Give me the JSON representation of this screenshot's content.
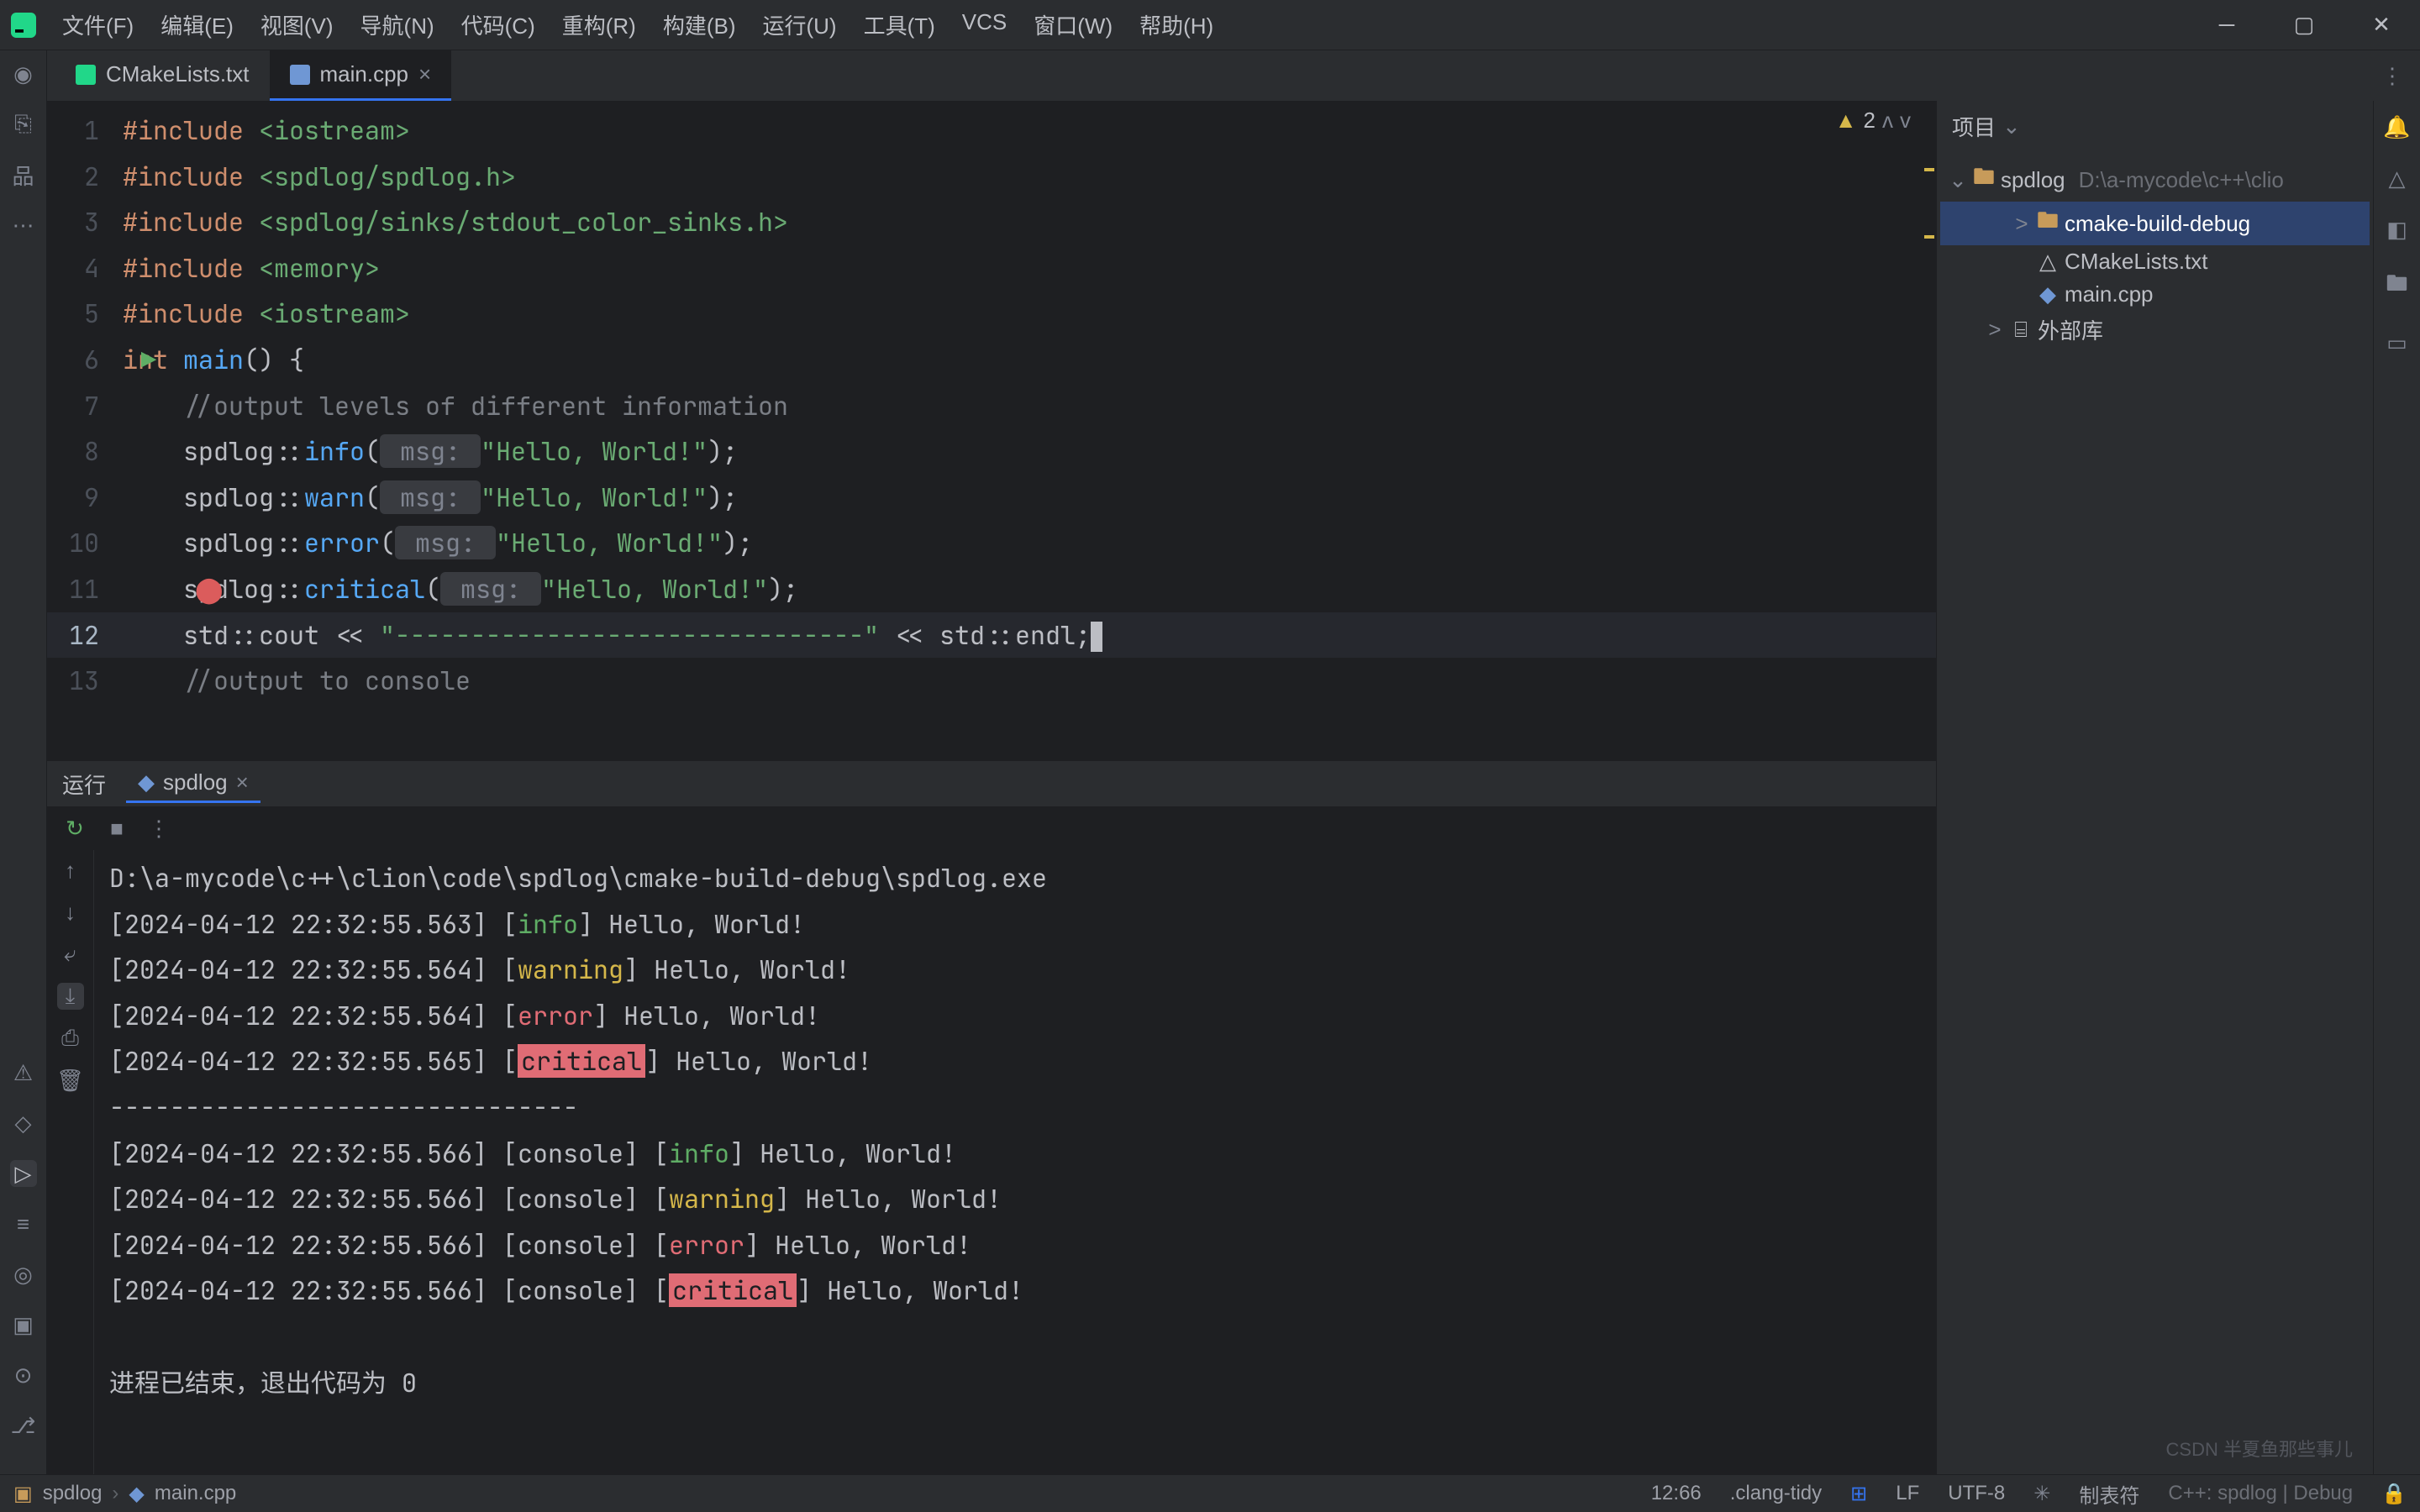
{
  "menubar": [
    "文件(F)",
    "编辑(E)",
    "视图(V)",
    "导航(N)",
    "代码(C)",
    "重构(R)",
    "构建(B)",
    "运行(U)",
    "工具(T)",
    "VCS",
    "窗口(W)",
    "帮助(H)"
  ],
  "tabs": [
    {
      "label": "CMakeLists.txt",
      "active": false
    },
    {
      "label": "main.cpp",
      "active": true
    }
  ],
  "warnings": {
    "count": "2"
  },
  "code_lines": [
    {
      "n": "1",
      "segs": [
        {
          "t": "#include ",
          "c": "pp"
        },
        {
          "t": "<iostream>",
          "c": "pp-path"
        }
      ]
    },
    {
      "n": "2",
      "segs": [
        {
          "t": "#include ",
          "c": "pp"
        },
        {
          "t": "<spdlog/spdlog.h>",
          "c": "pp-path"
        }
      ]
    },
    {
      "n": "3",
      "segs": [
        {
          "t": "#include ",
          "c": "pp"
        },
        {
          "t": "<spdlog/sinks/stdout_color_sinks.h>",
          "c": "pp-path"
        }
      ]
    },
    {
      "n": "4",
      "segs": [
        {
          "t": "#include ",
          "c": "pp"
        },
        {
          "t": "<memory>",
          "c": "pp-path"
        }
      ]
    },
    {
      "n": "5",
      "segs": [
        {
          "t": "#include ",
          "c": "pp"
        },
        {
          "t": "<iostream>",
          "c": "pp-path"
        }
      ]
    },
    {
      "n": "6",
      "run": true,
      "segs": [
        {
          "t": "int ",
          "c": "kw"
        },
        {
          "t": "main",
          "c": "method"
        },
        {
          "t": "() {",
          "c": "punct"
        }
      ]
    },
    {
      "n": "7",
      "segs": [
        {
          "t": "    ",
          "c": "punct"
        },
        {
          "t": "//output levels of different information",
          "c": "comment"
        }
      ]
    },
    {
      "n": "8",
      "segs": [
        {
          "t": "    spdlog::",
          "c": "name"
        },
        {
          "t": "info",
          "c": "method"
        },
        {
          "t": "(",
          "c": "punct"
        },
        {
          "t": " msg: ",
          "c": "param-hint"
        },
        {
          "t": "\"Hello, World!\"",
          "c": "str"
        },
        {
          "t": ");",
          "c": "punct"
        }
      ]
    },
    {
      "n": "9",
      "segs": [
        {
          "t": "    spdlog::",
          "c": "name"
        },
        {
          "t": "warn",
          "c": "method"
        },
        {
          "t": "(",
          "c": "punct"
        },
        {
          "t": " msg: ",
          "c": "param-hint"
        },
        {
          "t": "\"Hello, World!\"",
          "c": "str"
        },
        {
          "t": ");",
          "c": "punct"
        }
      ]
    },
    {
      "n": "10",
      "segs": [
        {
          "t": "    spdlog::",
          "c": "name"
        },
        {
          "t": "error",
          "c": "method"
        },
        {
          "t": "(",
          "c": "punct"
        },
        {
          "t": " msg: ",
          "c": "param-hint"
        },
        {
          "t": "\"Hello, World!\"",
          "c": "str"
        },
        {
          "t": ");",
          "c": "punct"
        }
      ]
    },
    {
      "n": "11",
      "bp": true,
      "segs": [
        {
          "t": "    spdlog::",
          "c": "name"
        },
        {
          "t": "critical",
          "c": "method"
        },
        {
          "t": "(",
          "c": "punct"
        },
        {
          "t": " msg: ",
          "c": "param-hint"
        },
        {
          "t": "\"Hello, World!\"",
          "c": "str"
        },
        {
          "t": ");",
          "c": "punct"
        }
      ]
    },
    {
      "n": "12",
      "current": true,
      "segs": [
        {
          "t": "    std::",
          "c": "name"
        },
        {
          "t": "cout",
          "c": "name"
        },
        {
          "t": " << ",
          "c": "punct"
        },
        {
          "t": "\"-------------------------------\"",
          "c": "str"
        },
        {
          "t": " << std::",
          "c": "punct"
        },
        {
          "t": "endl",
          "c": "name"
        },
        {
          "t": ";",
          "c": "punct"
        }
      ],
      "cursor": true
    },
    {
      "n": "13",
      "segs": [
        {
          "t": "    ",
          "c": "punct"
        },
        {
          "t": "//output to console",
          "c": "comment"
        }
      ]
    }
  ],
  "project": {
    "title": "项目",
    "root": {
      "label": "spdlog",
      "path": "D:\\a-mycode\\c++\\clio"
    },
    "rows": [
      {
        "indent": 1,
        "icon": "folder",
        "label": "cmake-build-debug",
        "chevron": ">",
        "selected": true
      },
      {
        "indent": 1,
        "icon": "file",
        "label": "CMakeLists.txt"
      },
      {
        "indent": 1,
        "icon": "cpp",
        "label": "main.cpp"
      },
      {
        "indent": 0,
        "icon": "lib",
        "label": "外部库",
        "chevron": ">"
      }
    ]
  },
  "run": {
    "label": "运行",
    "tab": "spdlog",
    "exe": "D:\\a-mycode\\c++\\clion\\code\\spdlog\\cmake-build-debug\\spdlog.exe",
    "lines": [
      {
        "ts": "[2024-04-12 22:32:55.563] ",
        "lv": "info",
        "lvtxt": "info",
        "msg": " Hello, World!"
      },
      {
        "ts": "[2024-04-12 22:32:55.564] ",
        "lv": "warn",
        "lvtxt": "warning",
        "msg": " Hello, World!"
      },
      {
        "ts": "[2024-04-12 22:32:55.564] ",
        "lv": "err",
        "lvtxt": "error",
        "msg": " Hello, World!"
      },
      {
        "ts": "[2024-04-12 22:32:55.565] ",
        "lv": "crit",
        "lvtxt": "critical",
        "msg": " Hello, World!"
      }
    ],
    "divider": "-------------------------------",
    "lines2": [
      {
        "ts": "[2024-04-12 22:32:55.566] [console] ",
        "lv": "info",
        "lvtxt": "info",
        "msg": " Hello, World!"
      },
      {
        "ts": "[2024-04-12 22:32:55.566] [console] ",
        "lv": "warn",
        "lvtxt": "warning",
        "msg": " Hello, World!"
      },
      {
        "ts": "[2024-04-12 22:32:55.566] [console] ",
        "lv": "err",
        "lvtxt": "error",
        "msg": " Hello, World!"
      },
      {
        "ts": "[2024-04-12 22:32:55.566] [console] ",
        "lv": "crit",
        "lvtxt": "critical",
        "msg": " Hello, World!"
      }
    ],
    "exit": "进程已结束，退出代码为 0"
  },
  "status": {
    "crumbs": [
      "spdlog",
      "main.cpp"
    ],
    "pos": "12:66",
    "linter": ".clang-tidy",
    "eol": "LF",
    "enc": "UTF-8",
    "indent": "制表符",
    "config": "C++: spdlog | Debug",
    "watermark": "CSDN 半夏鱼那些事儿"
  }
}
